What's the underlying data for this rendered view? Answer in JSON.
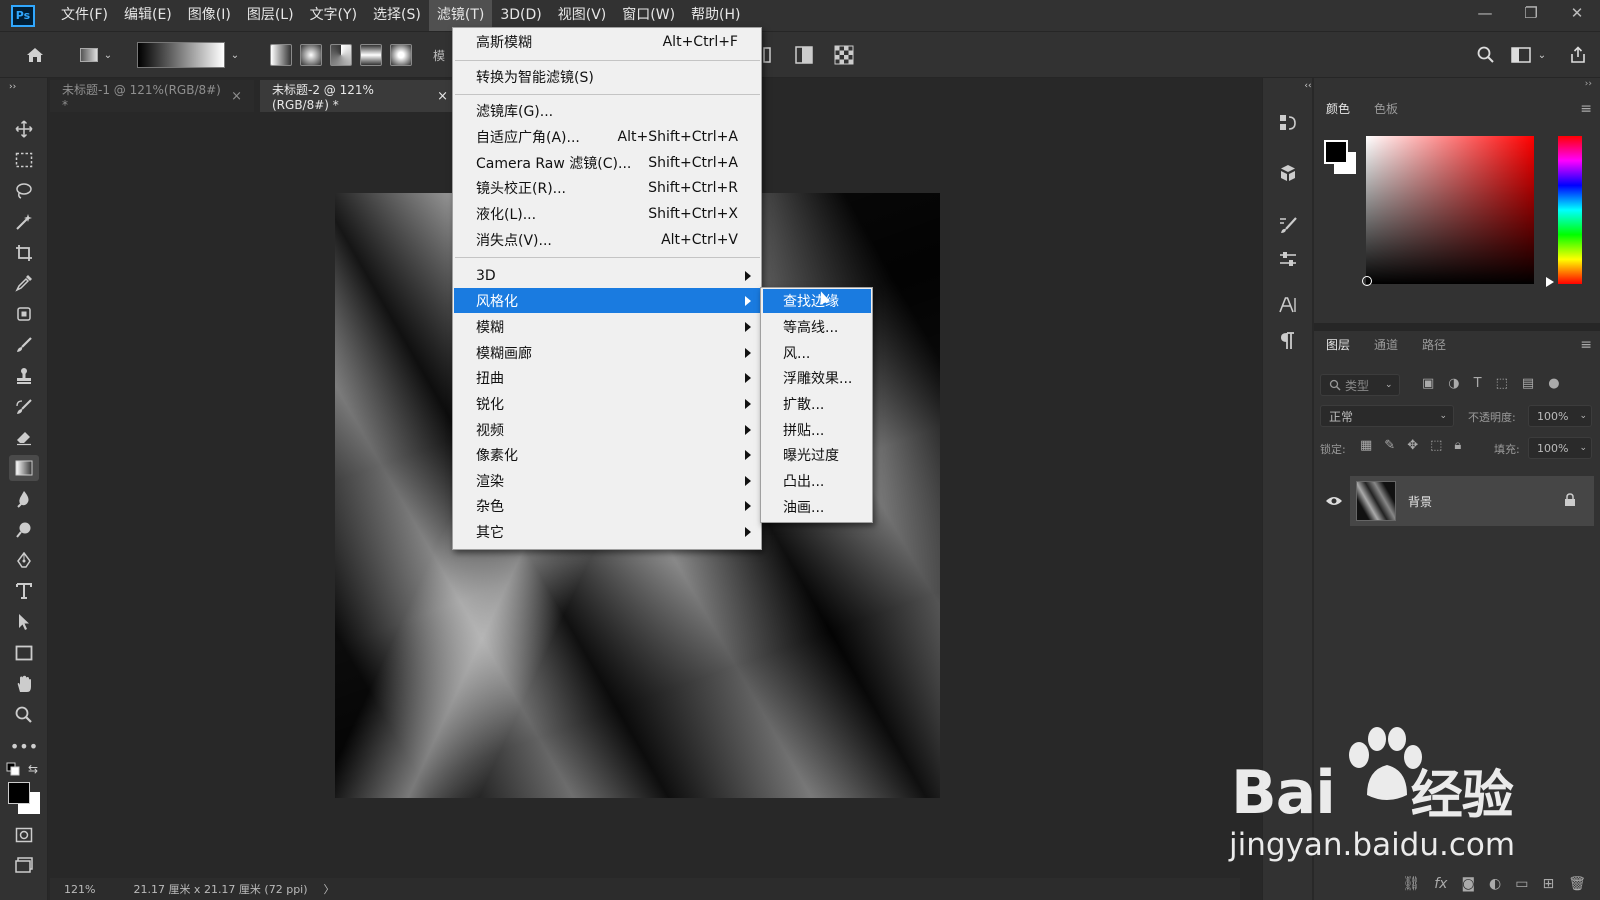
{
  "menubar": {
    "logo": "Ps",
    "items": [
      "文件(F)",
      "编辑(E)",
      "图像(I)",
      "图层(L)",
      "文字(Y)",
      "选择(S)",
      "滤镜(T)",
      "3D(D)",
      "视图(V)",
      "窗口(W)",
      "帮助(H)"
    ],
    "active_index": 6
  },
  "window_controls": {
    "minimize": "—",
    "restore": "❐",
    "close": "✕"
  },
  "tabs": [
    {
      "label": "未标题-1 @ 121%(RGB/8#) *",
      "close": "×"
    },
    {
      "label": "未标题-2 @ 121%(RGB/8#) *",
      "close": "×"
    }
  ],
  "filter_menu": {
    "items": [
      {
        "label": "高斯模糊",
        "shortcut": "Alt+Ctrl+F"
      },
      {
        "label": "转换为智能滤镜(S)",
        "shortcut": ""
      },
      {
        "label": "滤镜库(G)...",
        "shortcut": ""
      },
      {
        "label": "自适应广角(A)...",
        "shortcut": "Alt+Shift+Ctrl+A"
      },
      {
        "label": "Camera Raw 滤镜(C)...",
        "shortcut": "Shift+Ctrl+A"
      },
      {
        "label": "镜头校正(R)...",
        "shortcut": "Shift+Ctrl+R"
      },
      {
        "label": "液化(L)...",
        "shortcut": "Shift+Ctrl+X"
      },
      {
        "label": "消失点(V)...",
        "shortcut": "Alt+Ctrl+V"
      },
      {
        "label": "3D",
        "shortcut": ""
      },
      {
        "label": "风格化",
        "shortcut": ""
      },
      {
        "label": "模糊",
        "shortcut": ""
      },
      {
        "label": "模糊画廊",
        "shortcut": ""
      },
      {
        "label": "扭曲",
        "shortcut": ""
      },
      {
        "label": "锐化",
        "shortcut": ""
      },
      {
        "label": "视频",
        "shortcut": ""
      },
      {
        "label": "像素化",
        "shortcut": ""
      },
      {
        "label": "渲染",
        "shortcut": ""
      },
      {
        "label": "杂色",
        "shortcut": ""
      },
      {
        "label": "其它",
        "shortcut": ""
      }
    ],
    "highlighted": "风格化"
  },
  "stylize_submenu": {
    "items": [
      "查找边缘",
      "等高线...",
      "风...",
      "浮雕效果...",
      "扩散...",
      "拼贴...",
      "曝光过度",
      "凸出...",
      "油画..."
    ],
    "highlighted": "查找边缘"
  },
  "color_panel": {
    "tabs": [
      "颜色",
      "色板"
    ],
    "active_tab": "颜色",
    "hue": "#ff0000"
  },
  "layers_panel": {
    "tabs": [
      "图层",
      "通道",
      "路径"
    ],
    "active_tab": "图层",
    "filter_placeholder": "类型",
    "blend_mode": "正常",
    "opacity_label": "不透明度:",
    "opacity_value": "100%",
    "lock_label": "锁定:",
    "fill_label": "填充:",
    "fill_value": "100%",
    "layer": {
      "name": "背景",
      "visible": true,
      "locked": true
    }
  },
  "status": {
    "zoom": "121%",
    "doc_info": "21.17 厘米 x 21.17 厘米 (72 ppi)",
    "arrow": "〉"
  },
  "options_bar": {
    "text_fragment": "模"
  },
  "watermark": {
    "brand": "Bai",
    "brand_cn": "经验",
    "url": "jingyan.baidu.com"
  }
}
